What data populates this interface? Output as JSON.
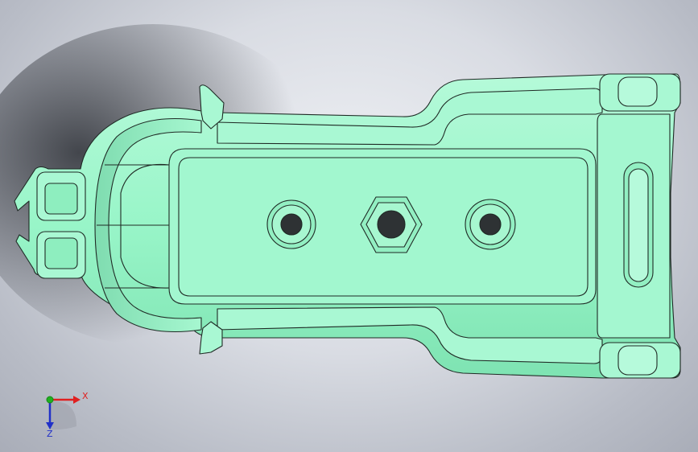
{
  "viewport": {
    "part_color": "#98f5c8",
    "edge_color": "#1f2a25",
    "background_colors": [
      "#eef0f4",
      "#a9adb8"
    ]
  },
  "triad": {
    "x_label": "X",
    "z_label": "Z",
    "x_color": "#e02020",
    "y_color": "#20b020",
    "z_color": "#2030c8"
  }
}
